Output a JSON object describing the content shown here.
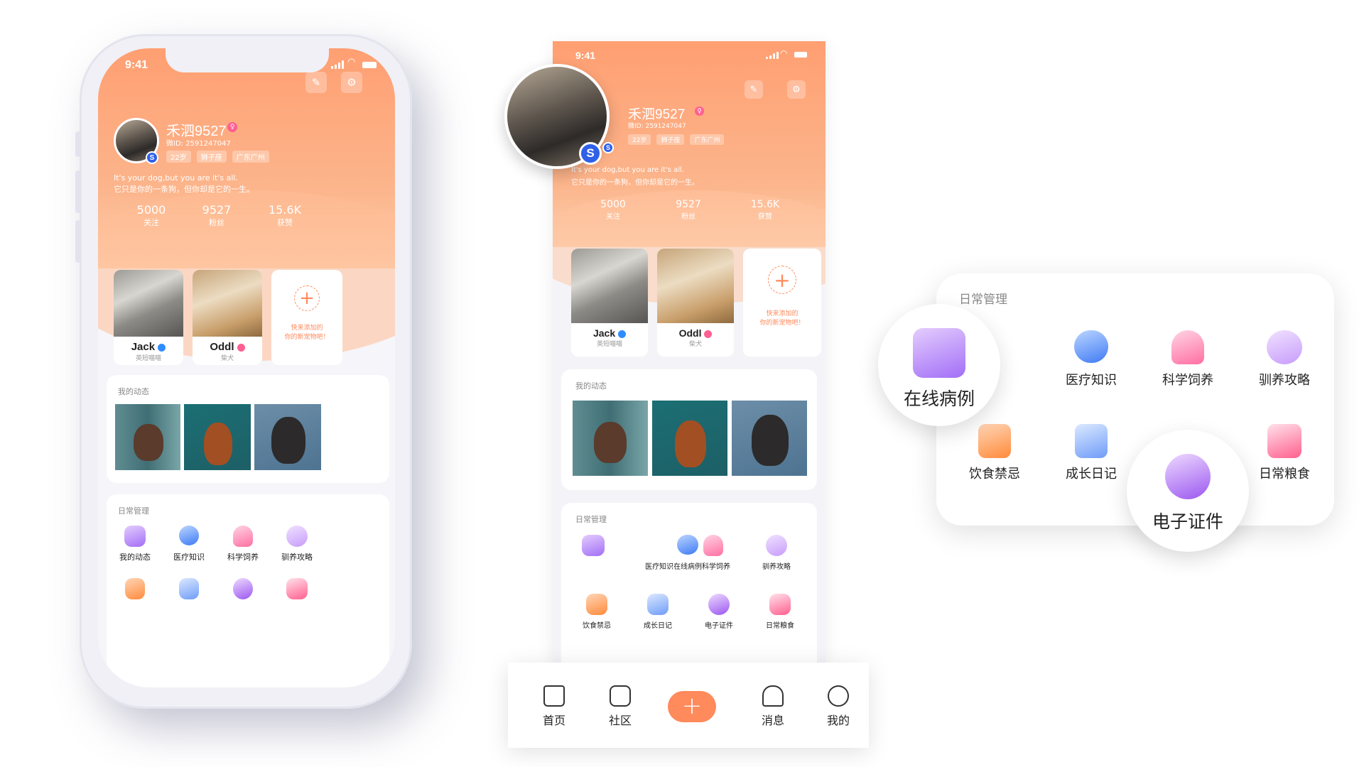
{
  "status": {
    "time": "9:41"
  },
  "profile": {
    "name": "禾泗9527",
    "id_line": "微ID: 2591247047",
    "tags": [
      "22岁",
      "狮子座",
      "广东广州"
    ],
    "badge": "S",
    "bio_en": "It's your dog,but you are it's all.",
    "bio_cn": "它只是你的一条狗，但你却是它的一生。",
    "stats": [
      {
        "value": "5000",
        "label": "关注"
      },
      {
        "value": "9527",
        "label": "粉丝"
      },
      {
        "value": "15.6K",
        "label": "获赞"
      }
    ]
  },
  "pets": [
    {
      "name": "Jack",
      "breed": "英短喵喵",
      "verify_color": "#2f8cff"
    },
    {
      "name": "Oddl",
      "breed": "柴犬",
      "verify_color": "#ff5f92"
    }
  ],
  "add_pet": {
    "plus": "+",
    "hint_line1": "快来添加的",
    "hint_line2": "你的新宠物吧！"
  },
  "moments": {
    "title": "我的动态"
  },
  "daily": {
    "title": "日常管理",
    "phone1_labels": [
      "我的动态",
      "医疗知识",
      "科学饲养",
      "驯养攻略"
    ],
    "phone2_top_labels": [
      "医疗知识在线病例科学饲养",
      "驯养攻略"
    ],
    "phone2_bottom_labels": [
      "饮食禁忌",
      "成长日记",
      "电子证件",
      "日常粮食"
    ],
    "card_top_labels": [
      "医疗知识",
      "科学饲养",
      "驯养攻略"
    ],
    "card_bottom_labels": [
      "饮食禁忌",
      "成长日记",
      "日常粮食"
    ],
    "bubble_online": "在线病例",
    "bubble_cert": "电子证件"
  },
  "tabbar": {
    "items": [
      "首页",
      "社区",
      "消息",
      "我的"
    ],
    "plus": "+"
  },
  "icons": [
    "edit-icon",
    "settings-icon",
    "home-icon",
    "camera-icon",
    "bell-icon",
    "user-icon"
  ],
  "colors": {
    "accent": "#ff8a5c",
    "header": "#ff9f72",
    "verify_blue": "#2f60e8"
  }
}
